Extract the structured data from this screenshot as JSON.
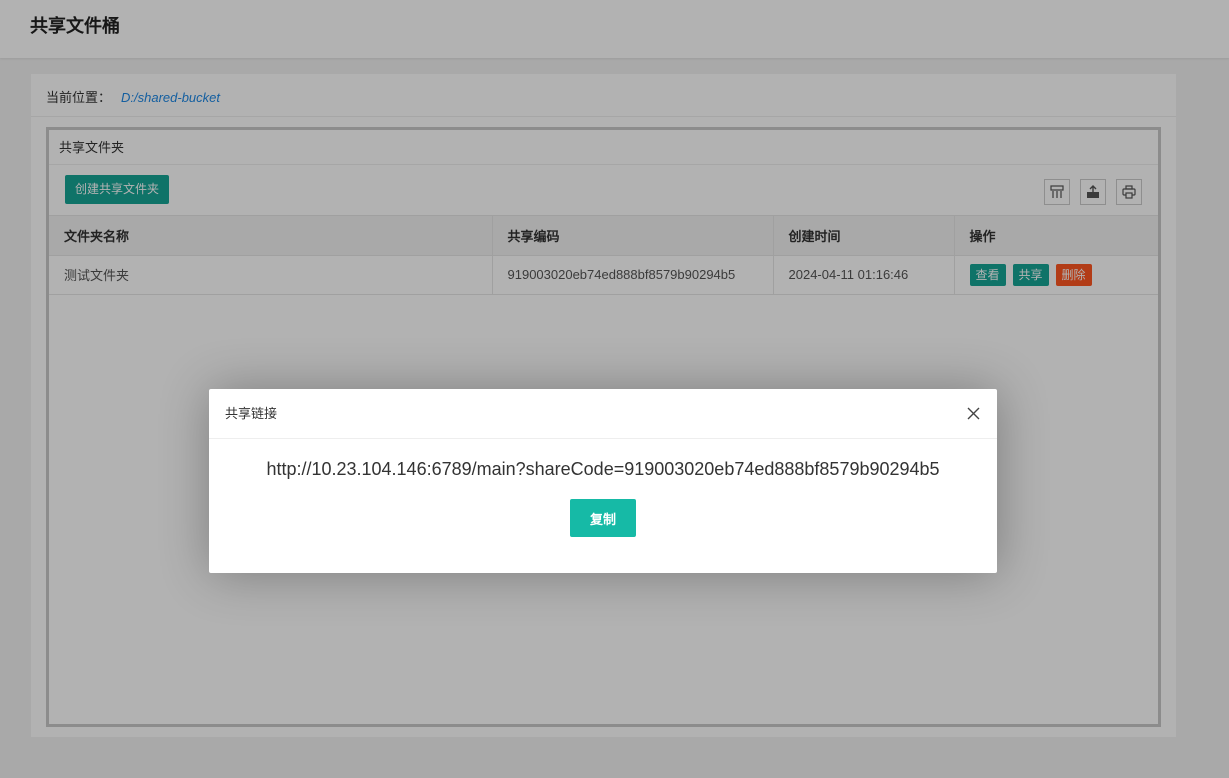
{
  "header": {
    "title": "共享文件桶"
  },
  "location": {
    "label": "当前位置：",
    "path": "D:/shared-bucket"
  },
  "panel": {
    "title": "共享文件夹",
    "create_button": "创建共享文件夹",
    "tool_icons": [
      "columns-icon",
      "export-icon",
      "print-icon"
    ]
  },
  "table": {
    "columns": [
      "文件夹名称",
      "共享编码",
      "创建时间",
      "操作"
    ],
    "rows": [
      {
        "name": "测试文件夹",
        "code": "919003020eb74ed888bf8579b90294b5",
        "created": "2024-04-11 01:16:46",
        "actions": {
          "view": "查看",
          "share": "共享",
          "delete": "删除"
        }
      }
    ]
  },
  "modal": {
    "title": "共享链接",
    "link": "http://10.23.104.146:6789/main?shareCode=919003020eb74ed888bf8579b90294b5",
    "copy_button": "复制"
  },
  "colors": {
    "accent": "#16a596",
    "danger": "#ff5722",
    "link": "#1e88e5"
  }
}
